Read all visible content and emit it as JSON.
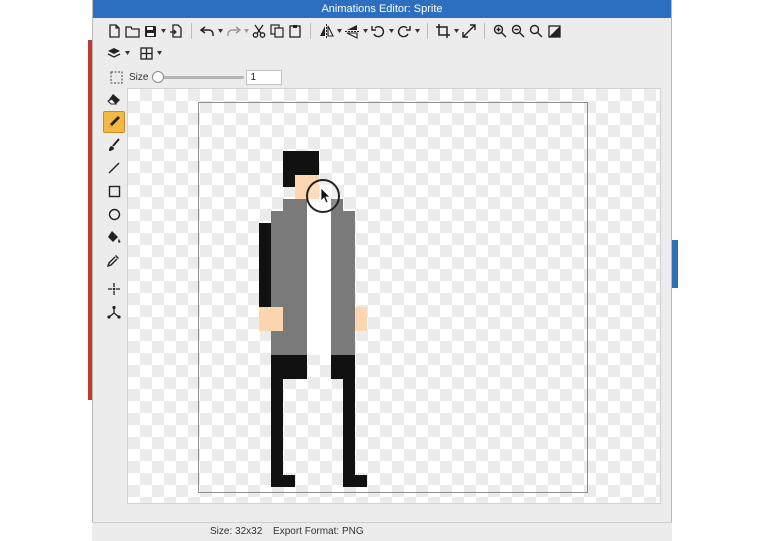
{
  "window": {
    "title": "Animations Editor: Sprite"
  },
  "toolbar": {
    "row1": [
      "new-file-icon",
      "open-folder-icon",
      "save-icon",
      "export-icon",
      "undo-icon",
      "redo-icon",
      "cut-icon",
      "copy-icon",
      "paste-icon",
      "flip-horizontal-icon",
      "flip-vertical-icon",
      "rotate-left-icon",
      "rotate-right-icon",
      "crop-icon",
      "resize-icon",
      "zoom-in-icon",
      "zoom-out-icon",
      "zoom-fit-icon",
      "background-icon"
    ],
    "row2": [
      "layers-icon",
      "grid-icon"
    ]
  },
  "options": {
    "size_label": "Size",
    "size_value": "1"
  },
  "tools": [
    "eraser-icon",
    "pencil-icon",
    "brush-icon",
    "line-icon",
    "rectangle-icon",
    "ellipse-icon",
    "fill-icon",
    "eyedropper-icon",
    "select-magic-icon",
    "rig-icon"
  ],
  "active_tool": "pencil-icon",
  "status": {
    "size": "Size: 32x32",
    "format": "Export Format: PNG"
  },
  "colors": {
    "title_bar": "#2c6fc1",
    "active_tool": "#f3b944",
    "coat": "#7a7a7a",
    "hair": "#111111",
    "skin": "#fcd6b0",
    "pants": "#111111"
  }
}
